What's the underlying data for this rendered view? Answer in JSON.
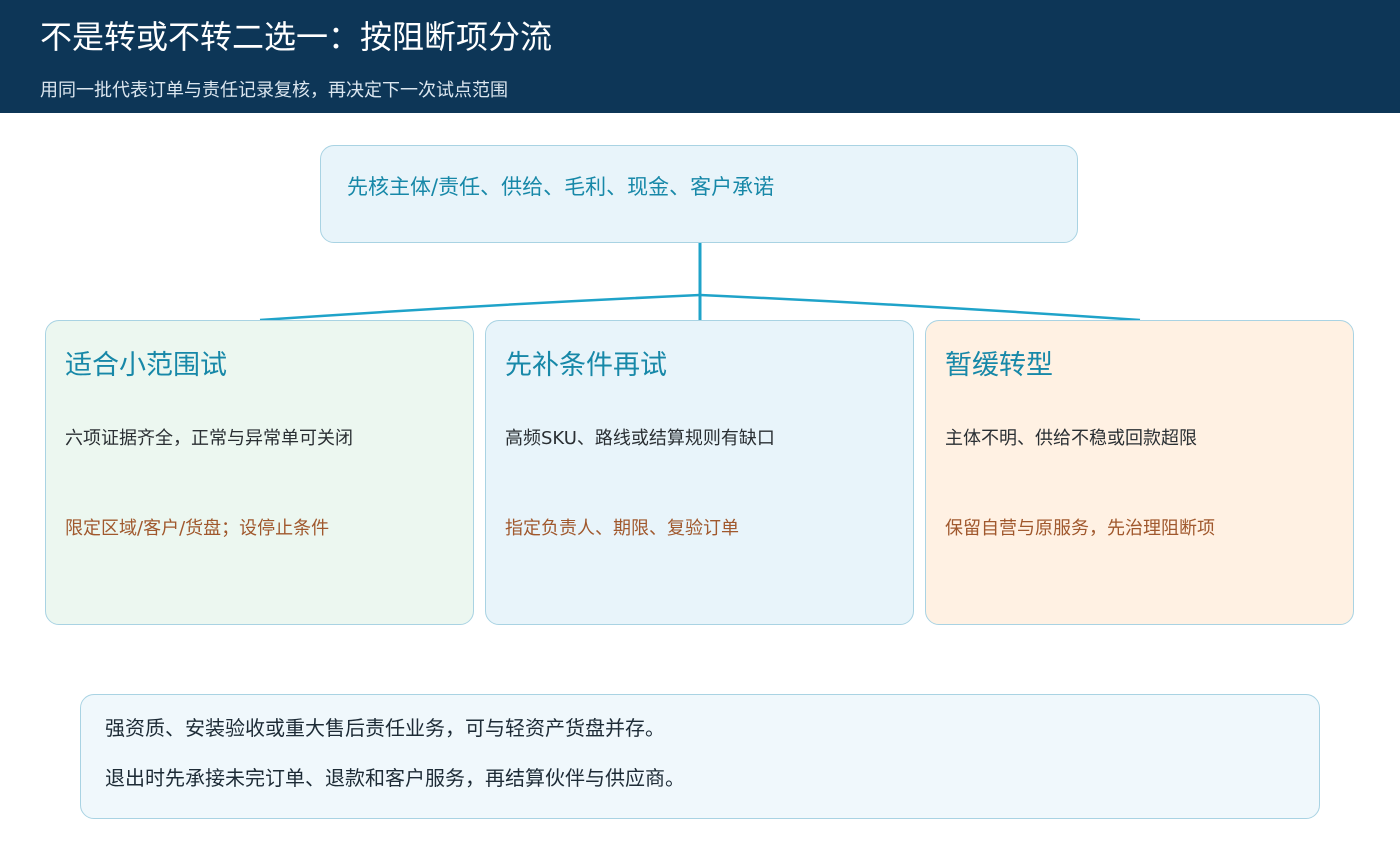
{
  "header": {
    "title": "不是转或不转二选一：按阻断项分流",
    "subtitle": "用同一批代表订单与责任记录复核，再决定下一次试点范围"
  },
  "root": {
    "text": "先核主体/责任、供给、毛利、现金、客户承诺"
  },
  "branches": [
    {
      "title": "适合小范围试",
      "condition": "六项证据齐全，正常与异常单可关闭",
      "action": "限定区域/客户/货盘；设停止条件"
    },
    {
      "title": "先补条件再试",
      "condition": "高频SKU、路线或结算规则有缺口",
      "action": "指定负责人、期限、复验订单"
    },
    {
      "title": "暂缓转型",
      "condition": "主体不明、供给不稳或回款超限",
      "action": "保留自营与原服务，先治理阻断项"
    }
  ],
  "note": {
    "line1": "强资质、安装验收或重大售后责任业务，可与轻资产货盘并存。",
    "line2": "退出时先承接未完订单、退款和客户服务，再结算伙伴与供应商。"
  },
  "colors": {
    "header_bg": "#0d3657",
    "accent": "#1788a8",
    "connector": "#1fa3c9",
    "action_text": "#a0582d",
    "branch_green_bg": "#ecf7f0",
    "branch_blue_bg": "#e8f4fa",
    "branch_orange_bg": "#fff1e3"
  }
}
